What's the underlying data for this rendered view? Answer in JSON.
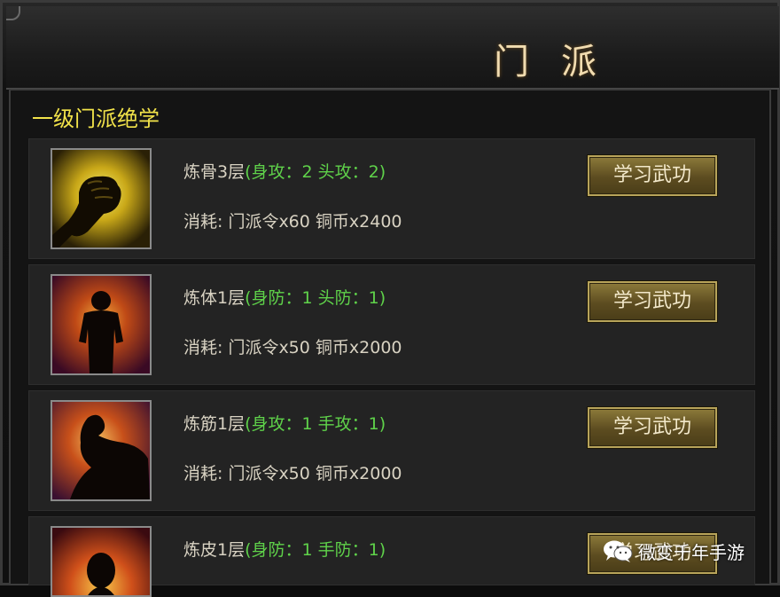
{
  "window": {
    "title": "门派"
  },
  "section": {
    "title": "一级门派绝学"
  },
  "skills": [
    {
      "name": "炼骨3层",
      "stat": "(身攻：2 头攻：2)",
      "cost": "消耗: 门派令x60 铜币x2400",
      "button_label": "学习武功",
      "icon": "fist-icon"
    },
    {
      "name": "炼体1层",
      "stat": "(身防：1 头防：1)",
      "cost": "消耗: 门派令x50 铜币x2000",
      "button_label": "学习武功",
      "icon": "body-flame-icon"
    },
    {
      "name": "炼筋1层",
      "stat": "(身攻：1 手攻：1)",
      "cost": "消耗: 门派令x50 铜币x2000",
      "button_label": "学习武功",
      "icon": "flexed-arm-icon"
    },
    {
      "name": "炼皮1层",
      "stat": "(身防：1 手防：1)",
      "cost": "",
      "button_label": "学习武功",
      "icon": "head-flame-icon"
    }
  ],
  "watermark": {
    "text": "微变千年手游",
    "icon": "wechat-icon"
  },
  "colors": {
    "title": "#f1dcb0",
    "section_title": "#f2e34a",
    "stat_green": "#5fd24a",
    "button_gold": "#8c7a3a"
  }
}
